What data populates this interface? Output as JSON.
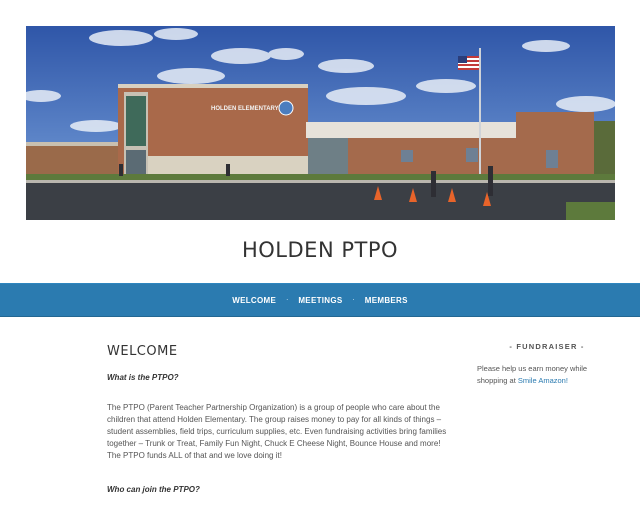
{
  "header": {
    "building_sign": "HOLDEN ELEMENTARY",
    "site_title": "HOLDEN PTPO"
  },
  "nav": {
    "items": [
      {
        "label": "WELCOME"
      },
      {
        "label": "MEETINGS"
      },
      {
        "label": "MEMBERS"
      }
    ],
    "separator": "·"
  },
  "main": {
    "page_title": "WELCOME",
    "question1": "What is the PTPO?",
    "answer1": "The PTPO (Parent Teacher Partnership Organization) is a group of people who care about the children that attend Holden Elementary. The group raises money to pay for all kinds of things – student assemblies, field trips, curriculum supplies, etc. Even fundraising activities bring families together – Trunk or Treat, Family Fun Night, Chuck E Cheese Night, Bounce House and more! The PTPO funds ALL of that and we love doing it!",
    "question2": "Who can join the PTPO?"
  },
  "sidebar": {
    "widget_title": "- FUNDRAISER -",
    "widget_text": "Please help us earn money while shopping at",
    "widget_link": "Smile Amazon!"
  },
  "colors": {
    "nav_bg": "#2b7bb0",
    "link": "#2b7bb0",
    "sky": "#3b5fae"
  }
}
